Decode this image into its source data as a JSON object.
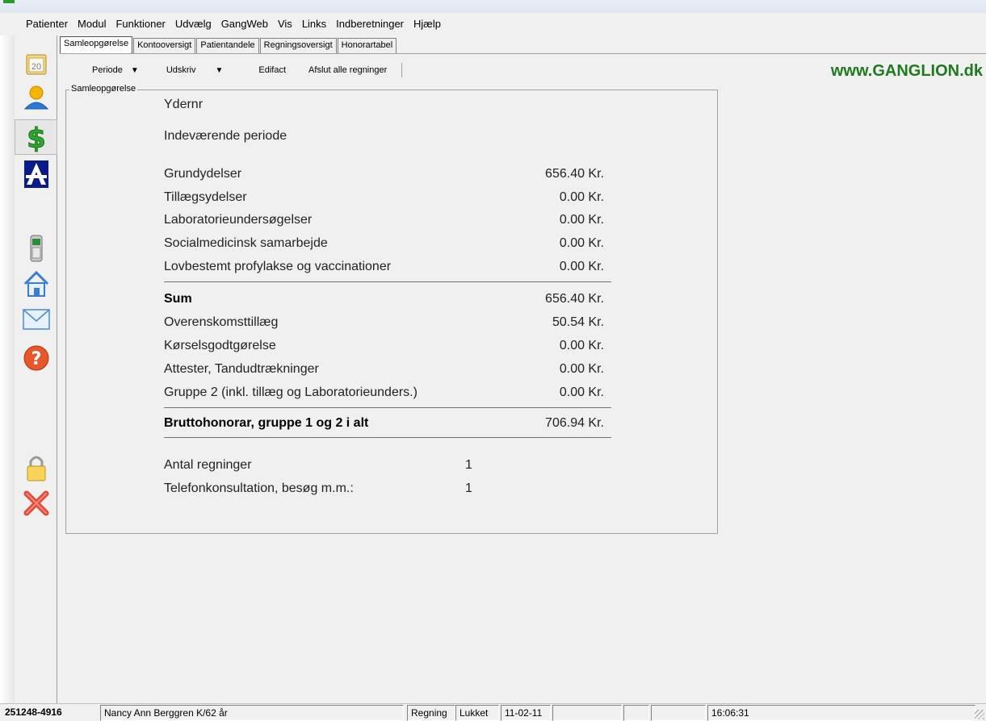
{
  "menubar": {
    "items": [
      "Patienter",
      "Modul",
      "Funktioner",
      "Udvælg",
      "GangWeb",
      "Vis",
      "Links",
      "Indberetninger",
      "Hjælp"
    ]
  },
  "sidebar": {
    "items": [
      {
        "icon": "calendar-icon",
        "label": "20"
      },
      {
        "icon": "person-icon"
      },
      {
        "icon": "dollar-icon"
      },
      {
        "icon": "a-logo-icon"
      },
      {
        "icon": "phone-icon"
      },
      {
        "icon": "home-icon"
      },
      {
        "icon": "mail-icon"
      },
      {
        "icon": "help-icon"
      },
      {
        "icon": "lock-icon"
      },
      {
        "icon": "close-icon"
      }
    ]
  },
  "tabs": [
    "Samleopgørelse",
    "Kontooversigt",
    "Patientandele",
    "Regningsoversigt",
    "Honorartabel"
  ],
  "toolbar": {
    "periode": "Periode",
    "udskriv": "Udskriv",
    "edifact": "Edifact",
    "afslut": "Afslut alle regninger"
  },
  "brand": "www.GANGLION.dk",
  "summary": {
    "group_title": "Samleopgørelse",
    "ydernr_label": "Ydernr",
    "period_label": "Indeværende periode",
    "rows1": [
      {
        "label": "Grundydelser",
        "value": "656.40 Kr."
      },
      {
        "label": "Tillægsydelser",
        "value": "0.00 Kr."
      },
      {
        "label": "Laboratorieundersøgelser",
        "value": "0.00 Kr."
      },
      {
        "label": "Socialmedicinsk samarbejde",
        "value": "0.00 Kr."
      },
      {
        "label": "Lovbestemt profylakse og vaccinationer",
        "value": "0.00 Kr."
      }
    ],
    "sum": {
      "label": "Sum",
      "value": "656.40 Kr."
    },
    "rows2": [
      {
        "label": "Overenskomsttillæg",
        "value": "50.54 Kr."
      },
      {
        "label": "Kørselsgodtgørelse",
        "value": "0.00 Kr."
      },
      {
        "label": "Attester, Tandudtrækninger",
        "value": "0.00 Kr."
      },
      {
        "label": "Gruppe 2 (inkl. tillæg og Laboratorieunders.)",
        "value": "0.00 Kr."
      }
    ],
    "total": {
      "label": "Bruttohonorar, gruppe 1 og 2 i alt",
      "value": "706.94 Kr."
    },
    "counts": [
      {
        "label": "Antal regninger",
        "value": "1"
      },
      {
        "label": "Telefonkonsultation, besøg m.m.:",
        "value": "1"
      }
    ]
  },
  "statusbar": {
    "cpr": "251248-4916",
    "patient": "Nancy Ann Berggren K/62 år",
    "regning": "Regning",
    "lukket": "Lukket",
    "date": "11-02-11",
    "time": "16:06:31"
  },
  "colors": {
    "brand": "#1f7a1f",
    "background": "#f0f0f0"
  }
}
